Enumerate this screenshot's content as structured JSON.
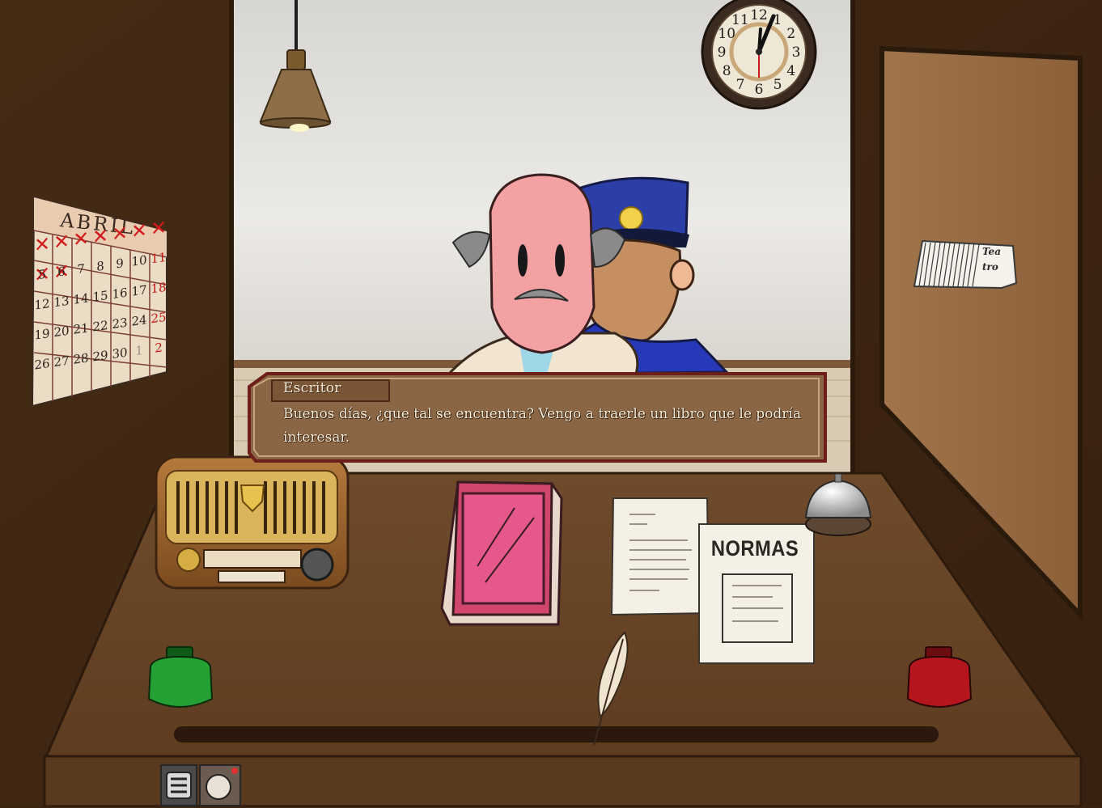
{
  "dialog": {
    "speaker": "Escritor",
    "text": "Buenos días, ¿que tal se encuentra? Vengo a traerle un libro que le podría interesar."
  },
  "calendar": {
    "month": "ABRIL",
    "rows": [
      [
        "",
        "",
        "",
        "",
        "",
        "",
        ""
      ],
      [
        "5",
        "6",
        "7",
        "8",
        "9",
        "10",
        "11"
      ],
      [
        "12",
        "13",
        "14",
        "15",
        "16",
        "17",
        "18"
      ],
      [
        "19",
        "20",
        "21",
        "22",
        "23",
        "24",
        "25"
      ],
      [
        "26",
        "27",
        "28",
        "29",
        "30",
        "1",
        "2"
      ]
    ],
    "crossed_days": 8
  },
  "desk": {
    "rules_title": "NORMAS"
  },
  "ticket": {
    "line1": "Tea",
    "line2": "tro"
  },
  "clock": {
    "numbers": [
      "12",
      "1",
      "2",
      "3",
      "4",
      "5",
      "6",
      "7",
      "8",
      "9",
      "10",
      "11"
    ],
    "hour": 12,
    "minute": 6
  },
  "colors": {
    "wall": "#3d2613",
    "desk": "#6b4628",
    "dialog_bg": "#8a6644",
    "dialog_border": "#6b1f18",
    "ink_green": "#1d8a2a",
    "ink_red": "#a3141a",
    "book": "#d1466d"
  },
  "icons": {
    "menu": "menu-lines-icon",
    "phone": "phone-dial-icon"
  }
}
